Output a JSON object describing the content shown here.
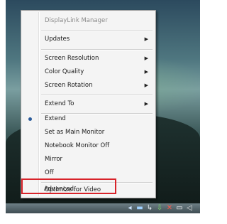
{
  "menu": {
    "header": "DisplayLink Manager",
    "updates": "Updates",
    "screen_resolution": "Screen Resolution",
    "color_quality": "Color Quality",
    "screen_rotation": "Screen Rotation",
    "extend_to": "Extend To",
    "extend": "Extend",
    "set_main": "Set as Main Monitor",
    "notebook_off": "Notebook Monitor Off",
    "mirror": "Mirror",
    "off": "Off",
    "optimize_video": "Optimize for Video",
    "advanced": "Advanced..."
  },
  "icons": {
    "submenu": "triangle-right-icon",
    "selected": "radio-bullet-icon"
  },
  "colors": {
    "highlight_border": "#d8232a",
    "menu_bg": "#f4f4f4"
  }
}
